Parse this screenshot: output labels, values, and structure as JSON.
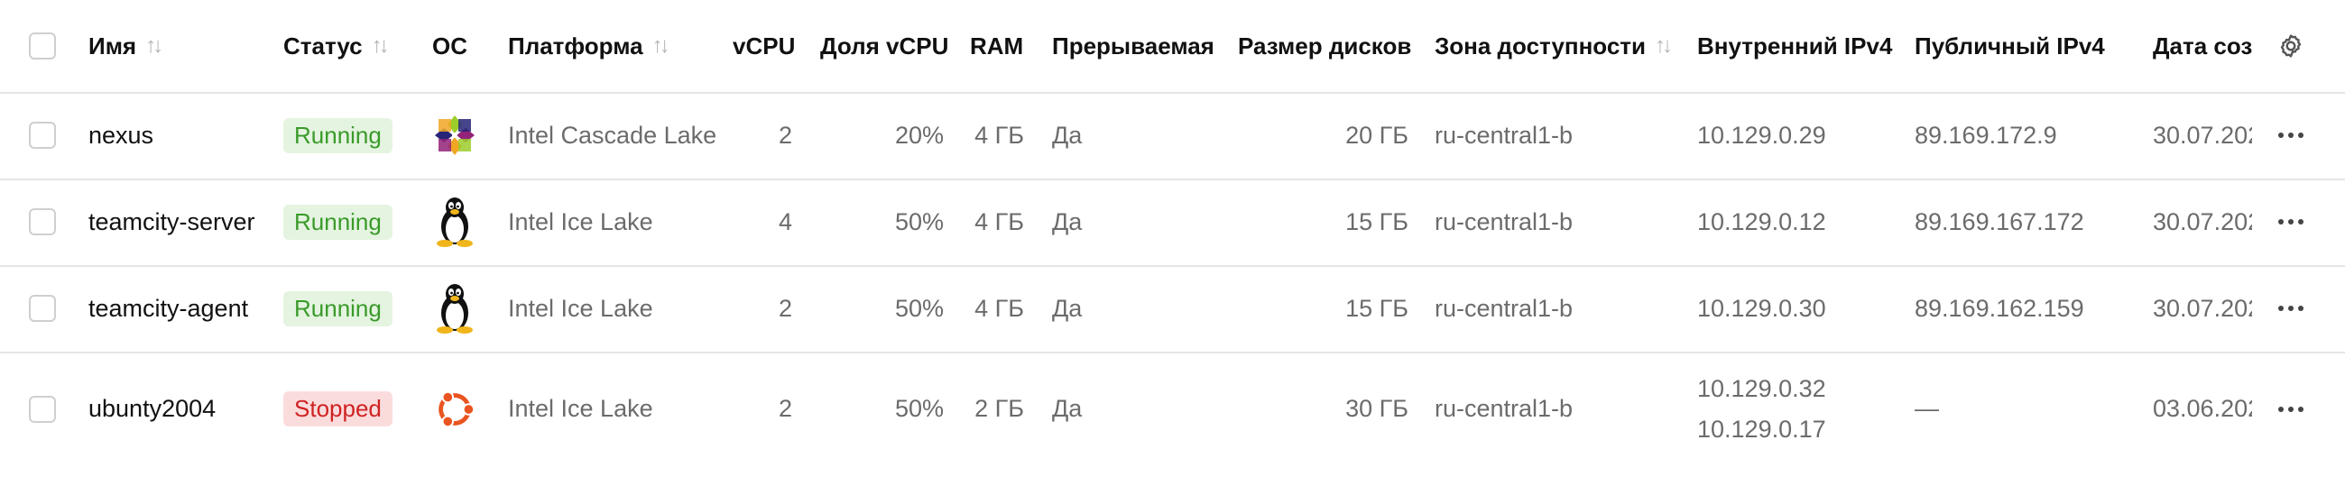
{
  "header": {
    "name": "Имя",
    "status": "Статус",
    "os": "ОС",
    "platform": "Платформа",
    "vcpu": "vCPU",
    "vcpu_share": "Доля vCPU",
    "ram": "RAM",
    "preemptible": "Прерываемая",
    "disk_size": "Размер дисков",
    "zone": "Зона доступности",
    "internal_ip": "Внутренний IPv4",
    "public_ip": "Публичный IPv4",
    "created": "Дата соз"
  },
  "rows": [
    {
      "name": "nexus",
      "status": "Running",
      "os_icon": "centos-icon",
      "platform": "Intel Cascade Lake",
      "vcpu": "2",
      "vcpu_share": "20%",
      "ram": "4 ГБ",
      "preemptible": "Да",
      "disk": "20 ГБ",
      "zone": "ru-central1-b",
      "internal_ip": [
        "10.129.0.29"
      ],
      "public_ip": "89.169.172.9",
      "created": "30.07.202"
    },
    {
      "name": "teamcity-server",
      "status": "Running",
      "os_icon": "linux-tux-icon",
      "platform": "Intel Ice Lake",
      "vcpu": "4",
      "vcpu_share": "50%",
      "ram": "4 ГБ",
      "preemptible": "Да",
      "disk": "15 ГБ",
      "zone": "ru-central1-b",
      "internal_ip": [
        "10.129.0.12"
      ],
      "public_ip": "89.169.167.172",
      "created": "30.07.202"
    },
    {
      "name": "teamcity-agent",
      "status": "Running",
      "os_icon": "linux-tux-icon",
      "platform": "Intel Ice Lake",
      "vcpu": "2",
      "vcpu_share": "50%",
      "ram": "4 ГБ",
      "preemptible": "Да",
      "disk": "15 ГБ",
      "zone": "ru-central1-b",
      "internal_ip": [
        "10.129.0.30"
      ],
      "public_ip": "89.169.162.159",
      "created": "30.07.202"
    },
    {
      "name": "ubunty2004",
      "status": "Stopped",
      "os_icon": "ubuntu-icon",
      "platform": "Intel Ice Lake",
      "vcpu": "2",
      "vcpu_share": "50%",
      "ram": "2 ГБ",
      "preemptible": "Да",
      "disk": "30 ГБ",
      "zone": "ru-central1-b",
      "internal_ip": [
        "10.129.0.32",
        "10.129.0.17"
      ],
      "public_ip": "—",
      "created": "03.06.202"
    }
  ],
  "colors": {
    "running_bg": "#e4f4e0",
    "running_fg": "#3a9a2a",
    "stopped_bg": "#fbdcdc",
    "stopped_fg": "#cf2222"
  }
}
